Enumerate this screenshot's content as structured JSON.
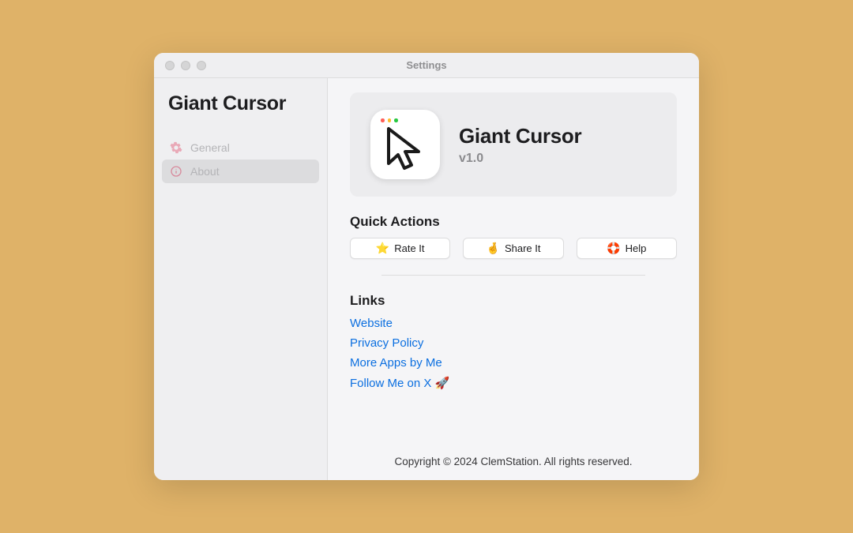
{
  "window": {
    "title": "Settings"
  },
  "sidebar": {
    "appName": "Giant Cursor",
    "items": [
      {
        "label": "General"
      },
      {
        "label": "About"
      }
    ]
  },
  "appCard": {
    "name": "Giant Cursor",
    "version": "v1.0"
  },
  "quickActions": {
    "title": "Quick Actions",
    "buttons": [
      {
        "icon": "⭐",
        "label": "Rate It"
      },
      {
        "icon": "🤞",
        "label": "Share It"
      },
      {
        "icon": "🛟",
        "label": "Help"
      }
    ]
  },
  "linksSection": {
    "title": "Links",
    "links": [
      {
        "label": "Website"
      },
      {
        "label": "Privacy Policy"
      },
      {
        "label": "More Apps by Me"
      },
      {
        "label": "Follow Me on X 🚀"
      }
    ]
  },
  "footer": {
    "copyright": "Copyright © 2024 ClemStation. All rights reserved."
  }
}
